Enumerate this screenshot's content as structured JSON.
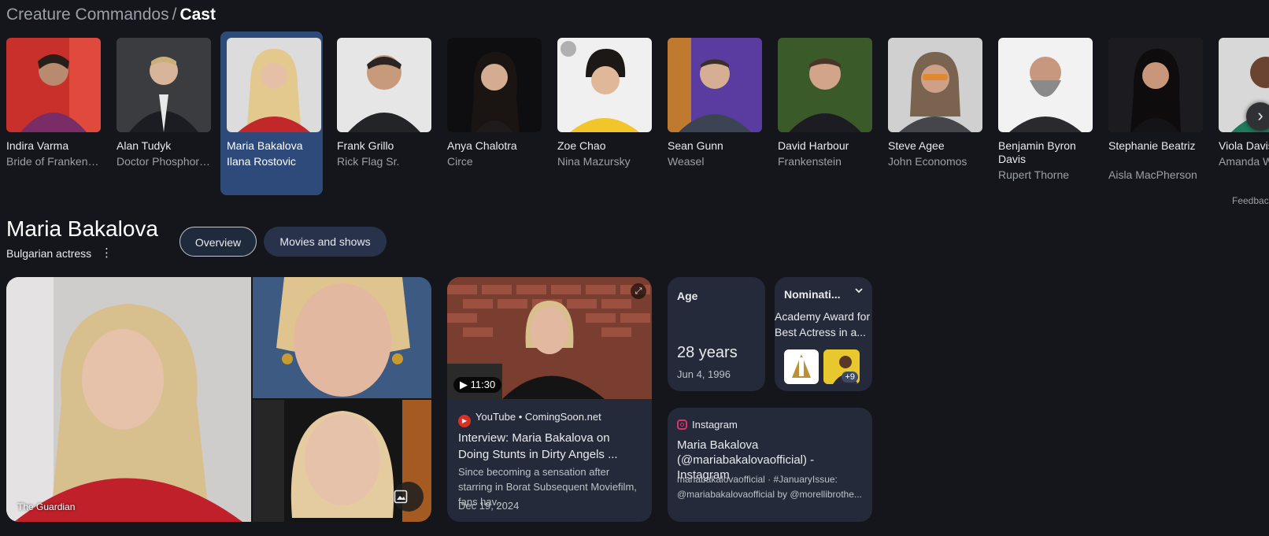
{
  "breadcrumb": {
    "section": "Creature Commandos",
    "separator": "/",
    "current": "Cast"
  },
  "cast": [
    {
      "name": "Indira Varma",
      "role": "Bride of Frankens…"
    },
    {
      "name": "Alan Tudyk",
      "role": "Doctor Phosphor…"
    },
    {
      "name": "Maria Bakalova",
      "role": "Ilana Rostovic",
      "selected": true
    },
    {
      "name": "Frank Grillo",
      "role": "Rick Flag Sr."
    },
    {
      "name": "Anya Chalotra",
      "role": "Circe"
    },
    {
      "name": "Zoe Chao",
      "role": "Nina Mazursky"
    },
    {
      "name": "Sean Gunn",
      "role": "Weasel"
    },
    {
      "name": "David Harbour",
      "role": "Frankenstein"
    },
    {
      "name": "Steve Agee",
      "role": "John Economos"
    },
    {
      "name": "Benjamin Byron Davis",
      "role": "Rupert Thorne"
    },
    {
      "name": "Stephanie Beatriz",
      "role": "Aisla MacPherson"
    },
    {
      "name": "Viola Davis",
      "role": "Amanda W…"
    }
  ],
  "feedback": "Feedback",
  "person": {
    "name": "Maria Bakalova",
    "description": "Bulgarian actress",
    "more_icon": "⋮"
  },
  "tabs": {
    "overview": "Overview",
    "movies": "Movies and shows"
  },
  "gallery": {
    "source": "The Guardian"
  },
  "video": {
    "duration": "▶ 11:30",
    "source": "YouTube • ComingSoon.net",
    "title": "Interview: Maria Bakalova on Doing Stunts in Dirty Angels ...",
    "snippet": "Since becoming a sensation after starring in Borat Subsequent Moviefilm, fans hav...",
    "date": "Dec 19, 2024"
  },
  "age": {
    "label": "Age",
    "value": "28 years",
    "birth": "Jun 4, 1996"
  },
  "nominations": {
    "label": "Nominati...",
    "text": "Academy Award for Best Actress in a...",
    "more": "+9"
  },
  "instagram": {
    "source": "Instagram",
    "title": "Maria Bakalova (@mariabakalovaofficial) - Instagram",
    "snippet": "mariabakalovaofficial · #JanuaryIssue: @mariabakalovaofficial by @morellibrothe..."
  },
  "colors": {
    "background": "#15161c",
    "selected": "#2e4a7a",
    "card": "#252a3a"
  },
  "icons": {
    "next": "chevron-right-icon",
    "gallery": "image-icon",
    "expand": "expand-icon",
    "chevron": "chevron-down-icon"
  }
}
